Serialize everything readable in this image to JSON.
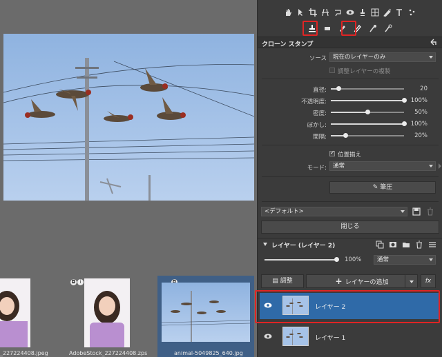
{
  "tools": {
    "row1": [
      "hand-icon",
      "pointer-icon",
      "crop-icon",
      "perspective-icon",
      "lasso-icon",
      "eye-icon",
      "brush-icon",
      "grid-icon",
      "pen-icon",
      "text-icon",
      "spray-icon"
    ],
    "row2": [
      "clone-stamp-icon",
      "eraser-icon",
      "smudge-icon",
      "healing-brush-icon",
      "dodge-icon",
      "burn-icon"
    ]
  },
  "panel": {
    "title": "クローン スタンプ",
    "source_label": "ソース",
    "source_value": "現在のレイヤーのみ",
    "adjust_layers_label": "調整レイヤーの複製",
    "sliders": [
      {
        "label": "直径:",
        "value": "20",
        "fraction": 0.1
      },
      {
        "label": "不透明度:",
        "value": "100%",
        "fraction": 1.0
      },
      {
        "label": "密度:",
        "value": "50%",
        "fraction": 0.5
      },
      {
        "label": "ぼかし:",
        "value": "100%",
        "fraction": 1.0
      },
      {
        "label": "間隔:",
        "value": "20%",
        "fraction": 0.2
      }
    ],
    "align_label": "位置揃え",
    "mode_label": "モード:",
    "mode_value": "通常",
    "pressure_button": "筆圧",
    "preset_value": "<デフォルト>",
    "close_button": "閉じる"
  },
  "layers": {
    "header": "レイヤー (レイヤー 2)",
    "opacity_value": "100%",
    "opacity_fraction": 1.0,
    "blend_mode": "通常",
    "adjust_button": "調整",
    "add_layer_button": "レイヤーの追加",
    "fx_button": "fx",
    "items": [
      {
        "name": "レイヤー 2",
        "selected": true
      },
      {
        "name": "レイヤー 1",
        "selected": false
      }
    ]
  },
  "filmstrip": [
    {
      "caption": "_227224408.jpeg"
    },
    {
      "caption": "AdobeStock_227224408.zps"
    },
    {
      "caption": "animal-5049825_640.jpg"
    }
  ],
  "colors": {
    "selection_blue": "#2f6aa8",
    "highlight_red": "#e02424",
    "sky": "#a6c3e8"
  }
}
